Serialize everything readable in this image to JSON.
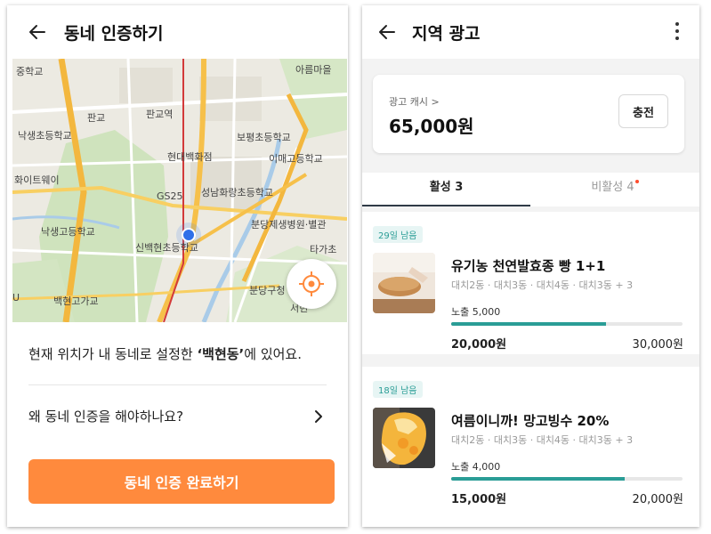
{
  "left": {
    "title": "동네 인증하기",
    "map_labels": [
      "중학교",
      "아름마을",
      "판교",
      "판교역",
      "낙생초등학교",
      "보평초등학교",
      "현대백화점",
      "이매고등학교",
      "화이트웨이",
      "GS25",
      "성남화랑초등학교",
      "분당제생병원·별관",
      "낙생고등학교",
      "신백현초등학교",
      "타가초",
      "분당구청",
      "U",
      "백현고가교",
      "서현"
    ],
    "info_text_before": "현재 위치가 내 동네로 설정한 ",
    "info_text_highlight": "‘백현동’",
    "info_text_after": "에 있어요.",
    "why_label": "왜 동네 인증을 해야하나요?",
    "complete_button": "동네 인증 완료하기",
    "accent_color": "#ff8a3d"
  },
  "right": {
    "title": "지역 광고",
    "cash": {
      "label": "광고 캐시 >",
      "amount": "65,000원",
      "charge_button": "충전"
    },
    "tabs": {
      "active": "활성 3",
      "inactive": "비활성 4"
    },
    "ads": [
      {
        "days_left": "29일 남음",
        "title": "유기농 천연발효종 빵 1+1",
        "areas": "대치2동 · 대치3동 · 대치4동 · 대치3동 + 3",
        "exposure": "노출 5,000",
        "progress": 0.67,
        "spent": "20,000원",
        "budget": "30,000원"
      },
      {
        "days_left": "18일 남음",
        "title": "여름이니까! 망고빙수 20%",
        "areas": "대치2동 · 대치3동 · 대치4동 · 대치3동 + 3",
        "exposure": "노출 4,000",
        "progress": 0.75,
        "spent": "15,000원",
        "budget": "20,000원"
      }
    ],
    "accent_color": "#2a9d96"
  }
}
